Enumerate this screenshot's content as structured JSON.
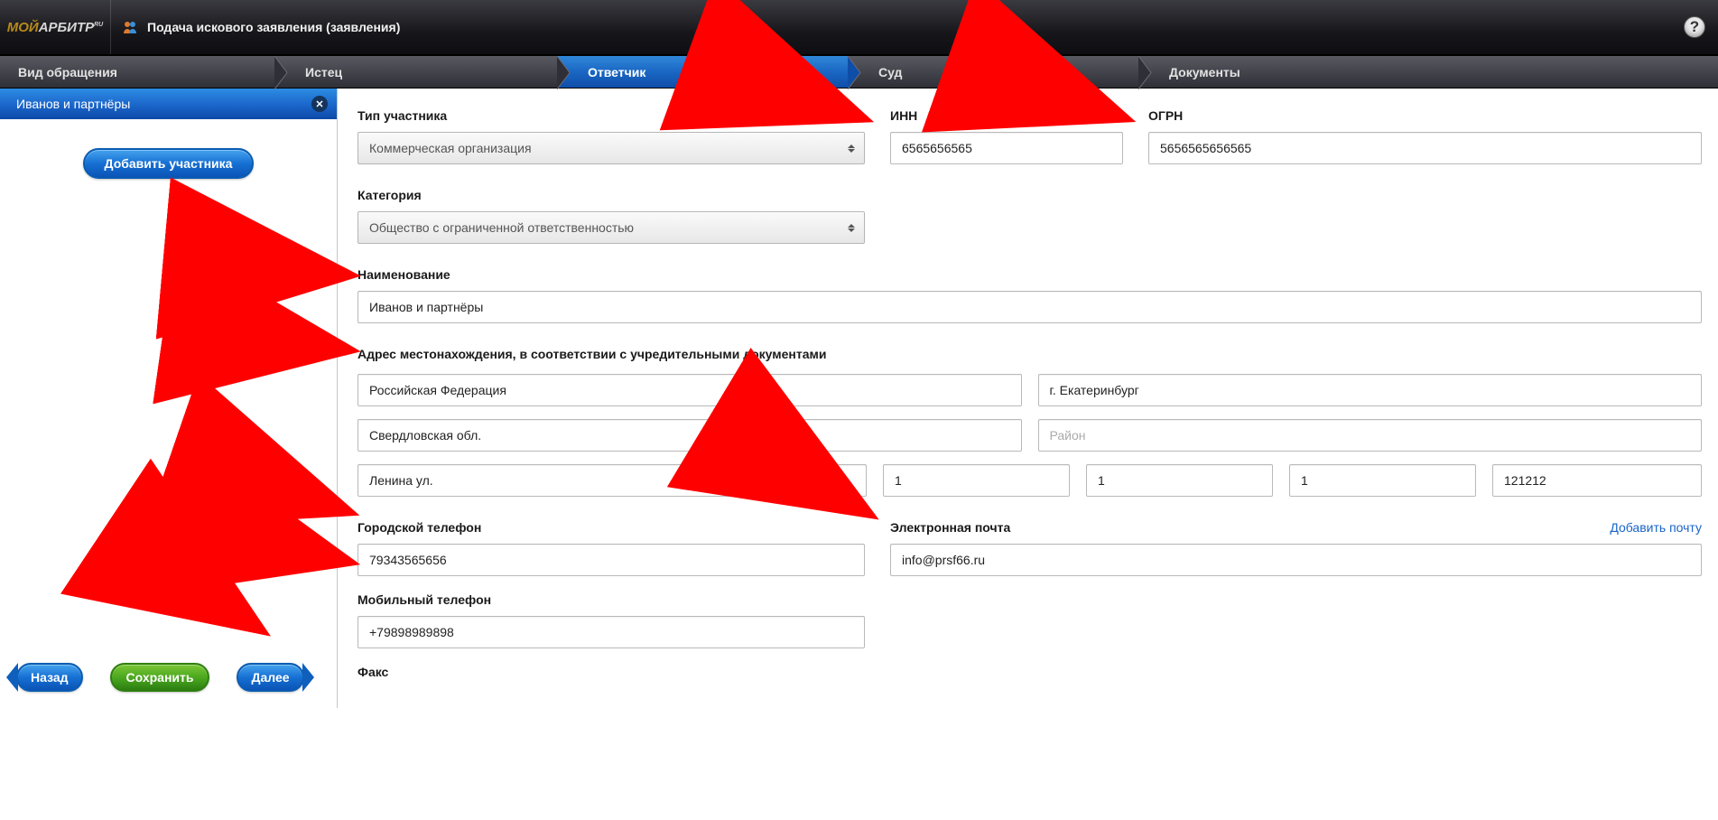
{
  "header": {
    "logo_moi": "МОЙ",
    "logo_arb": "АРБИТР",
    "logo_sup": "RU",
    "title": "Подача искового заявления (заявления)"
  },
  "steps": {
    "s0": "Вид обращения",
    "s1": "Истец",
    "s2": "Ответчик",
    "s3": "Суд",
    "s4": "Документы"
  },
  "sidebar": {
    "active_participant": "Иванов и партнёры",
    "add_button": "Добавить участника",
    "back": "Назад",
    "save": "Сохранить",
    "next": "Далее"
  },
  "form": {
    "labels": {
      "tip": "Тип участника",
      "inn": "ИНН",
      "ogrn": "ОГРН",
      "category": "Категория",
      "name": "Наименование",
      "address": "Адрес местонахождения, в соответствии с учредительными документами",
      "city_phone": "Городской телефон",
      "email": "Электронная почта",
      "add_email": "Добавить почту",
      "mobile": "Мобильный телефон",
      "fax": "Факс"
    },
    "values": {
      "tip": "Коммерческая организация",
      "inn": "6565656565",
      "ogrn": "5656565656565",
      "category": "Общество с ограниченной ответственностью",
      "name": "Иванов и партнёры",
      "country": "Российская Федерация",
      "city": "г. Екатеринбург",
      "region": "Свердловская обл.",
      "district_ph": "Район",
      "street": "Ленина ул.",
      "a1": "1",
      "a2": "1",
      "a3": "1",
      "a4": "121212",
      "city_phone": "79343565656",
      "email": "info@prsf66.ru",
      "mobile": "+79898989898"
    }
  }
}
